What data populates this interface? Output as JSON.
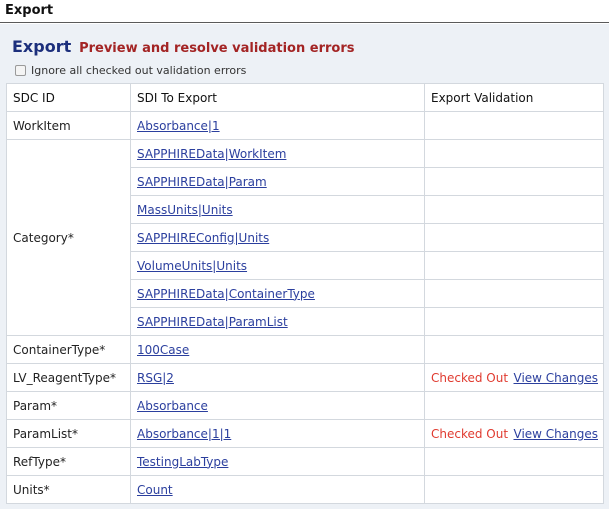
{
  "window": {
    "title": "Export"
  },
  "header": {
    "title": "Export",
    "subtitle": "Preview and resolve validation errors"
  },
  "ignore_option": {
    "label": "Ignore all checked out validation errors",
    "checked": false
  },
  "table": {
    "columns": [
      "SDC ID",
      "SDI To Export",
      "Export Validation"
    ],
    "groups": [
      {
        "sdc_id": "WorkItem",
        "items": [
          {
            "sdi": "Absorbance|1",
            "status": "",
            "action": ""
          }
        ]
      },
      {
        "sdc_id": "Category*",
        "items": [
          {
            "sdi": "SAPPHIREData|WorkItem",
            "status": "",
            "action": ""
          },
          {
            "sdi": "SAPPHIREData|Param",
            "status": "",
            "action": ""
          },
          {
            "sdi": "MassUnits|Units",
            "status": "",
            "action": ""
          },
          {
            "sdi": "SAPPHIREConfig|Units",
            "status": "",
            "action": ""
          },
          {
            "sdi": "VolumeUnits|Units",
            "status": "",
            "action": ""
          },
          {
            "sdi": "SAPPHIREData|ContainerType",
            "status": "",
            "action": ""
          },
          {
            "sdi": "SAPPHIREData|ParamList",
            "status": "",
            "action": ""
          }
        ]
      },
      {
        "sdc_id": "ContainerType*",
        "items": [
          {
            "sdi": "100Case",
            "status": "",
            "action": ""
          }
        ]
      },
      {
        "sdc_id": "LV_ReagentType*",
        "items": [
          {
            "sdi": "RSG|2",
            "status": "Checked Out",
            "action": "View Changes"
          }
        ]
      },
      {
        "sdc_id": "Param*",
        "items": [
          {
            "sdi": "Absorbance",
            "status": "",
            "action": ""
          }
        ]
      },
      {
        "sdc_id": "ParamList*",
        "items": [
          {
            "sdi": "Absorbance|1|1",
            "status": "Checked Out",
            "action": "View Changes"
          }
        ]
      },
      {
        "sdc_id": "RefType*",
        "items": [
          {
            "sdi": "TestingLabType",
            "status": "",
            "action": ""
          }
        ]
      },
      {
        "sdc_id": "Units*",
        "items": [
          {
            "sdi": "Count",
            "status": "",
            "action": ""
          }
        ]
      }
    ]
  },
  "colors": {
    "title": "#1c2f7c",
    "subtitle": "#a32424",
    "link": "#2b3f9e",
    "checked_out": "#e03a2f",
    "panel_bg": "#edf1f6"
  }
}
